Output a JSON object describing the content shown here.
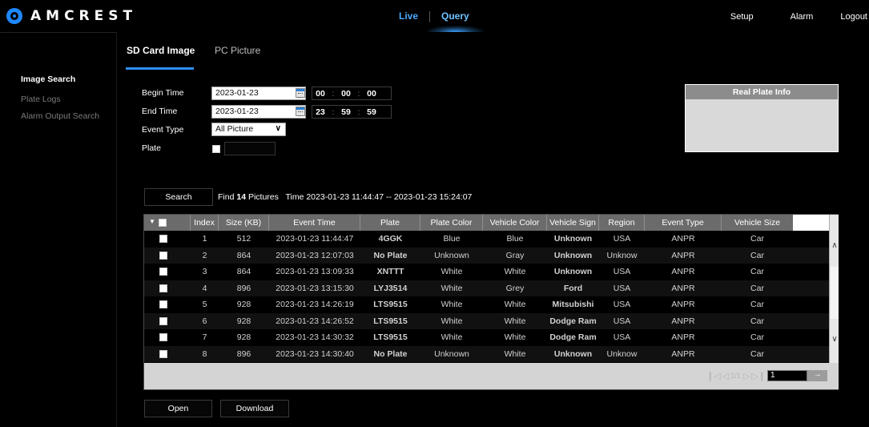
{
  "brand": "AMCREST",
  "topnav": {
    "live": "Live",
    "query": "Query",
    "setup": "Setup",
    "alarm": "Alarm",
    "logout": "Logout"
  },
  "sidebar": {
    "items": [
      "Image Search",
      "Plate Logs",
      "Alarm Output Search"
    ]
  },
  "tabs": {
    "sd": "SD Card Image",
    "pc": "PC Picture"
  },
  "form": {
    "begin_label": "Begin Time",
    "end_label": "End Time",
    "event_label": "Event Type",
    "plate_label": "Plate",
    "begin_date": "2023-01-23",
    "end_date": "2023-01-23",
    "begin_time": {
      "h": "00",
      "m": "00",
      "s": "00"
    },
    "end_time": {
      "h": "23",
      "m": "59",
      "s": "59"
    },
    "time_sep": ":",
    "event_type": "All Picture"
  },
  "plate_info": {
    "title": "Real Plate Info"
  },
  "search": {
    "button": "Search",
    "find_prefix": "Find",
    "count": "14",
    "find_suffix": "Pictures",
    "time_text": "Time 2023-01-23 11:44:47 -- 2023-01-23 15:24:07"
  },
  "table": {
    "headers": [
      "Index",
      "Size (KB)",
      "Event Time",
      "Plate",
      "Plate Color",
      "Vehicle Color",
      "Vehicle Sign",
      "Region",
      "Event Type",
      "Vehicle Size"
    ],
    "rows": [
      [
        "1",
        "512",
        "2023-01-23 11:44:47",
        "4GGK",
        "Blue",
        "Blue",
        "Unknown",
        "USA",
        "ANPR",
        "Car"
      ],
      [
        "2",
        "864",
        "2023-01-23 12:07:03",
        "No Plate",
        "Unknown",
        "Gray",
        "Unknown",
        "Unknow",
        "ANPR",
        "Car"
      ],
      [
        "3",
        "864",
        "2023-01-23 13:09:33",
        "XNTTT",
        "White",
        "White",
        "Unknown",
        "USA",
        "ANPR",
        "Car"
      ],
      [
        "4",
        "896",
        "2023-01-23 13:15:30",
        "LYJ3514",
        "White",
        "Grey",
        "Ford",
        "USA",
        "ANPR",
        "Car"
      ],
      [
        "5",
        "928",
        "2023-01-23 14:26:19",
        "LTS9515",
        "White",
        "White",
        "Mitsubishi",
        "USA",
        "ANPR",
        "Car"
      ],
      [
        "6",
        "928",
        "2023-01-23 14:26:52",
        "LTS9515",
        "White",
        "White",
        "Dodge Ram",
        "USA",
        "ANPR",
        "Car"
      ],
      [
        "7",
        "928",
        "2023-01-23 14:30:32",
        "LTS9515",
        "White",
        "White",
        "Dodge Ram",
        "USA",
        "ANPR",
        "Car"
      ],
      [
        "8",
        "896",
        "2023-01-23 14:30:40",
        "No Plate",
        "Unknown",
        "White",
        "Unknown",
        "Unknow",
        "ANPR",
        "Car"
      ]
    ]
  },
  "pager": {
    "info": "1/1",
    "page": "1",
    "go": "→"
  },
  "actions": {
    "open": "Open",
    "download": "Download"
  }
}
